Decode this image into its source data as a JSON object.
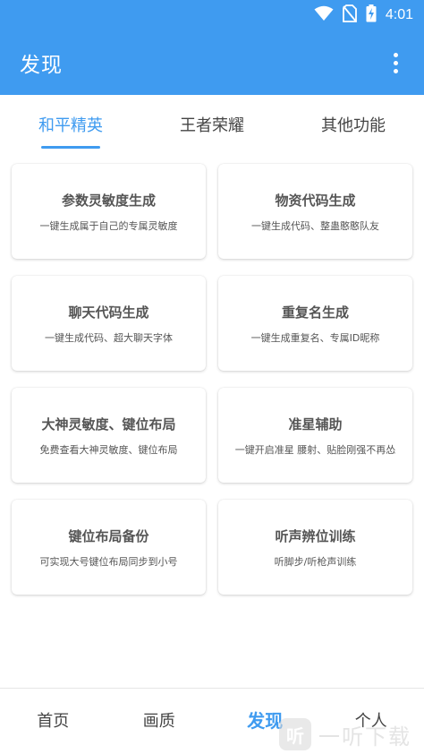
{
  "status_bar": {
    "time": "4:01",
    "icons": [
      "wifi-icon",
      "no-sim-icon",
      "battery-charging-icon"
    ]
  },
  "app_bar": {
    "title": "发现",
    "menu_icon": "more-vert-icon"
  },
  "tabs": [
    {
      "label": "和平精英",
      "active": true
    },
    {
      "label": "王者荣耀",
      "active": false
    },
    {
      "label": "其他功能",
      "active": false
    }
  ],
  "cards": [
    {
      "title": "参数灵敏度生成",
      "desc": "一键生成属于自己的专属灵敏度"
    },
    {
      "title": "物资代码生成",
      "desc": "一键生成代码、整蛊憨憨队友"
    },
    {
      "title": "聊天代码生成",
      "desc": "一键生成代码、超大聊天字体"
    },
    {
      "title": "重复名生成",
      "desc": "一键生成重复名、专属ID昵称"
    },
    {
      "title": "大神灵敏度、键位布局",
      "desc": "免费查看大神灵敏度、键位布局"
    },
    {
      "title": "准星辅助",
      "desc": "一键开启准星 腰射、贴脸刚强不再怂"
    },
    {
      "title": "键位布局备份",
      "desc": "可实现大号键位布局同步到小号"
    },
    {
      "title": "听声辨位训练",
      "desc": "听脚步/听枪声训练"
    }
  ],
  "bottom_nav": [
    {
      "label": "首页",
      "active": false
    },
    {
      "label": "画质",
      "active": false
    },
    {
      "label": "发现",
      "active": true
    },
    {
      "label": "个人",
      "active": false
    }
  ],
  "watermark": {
    "logo_char": "听",
    "text": "一听下载"
  },
  "colors": {
    "primary": "#3f9bf0",
    "text": "#444444",
    "card_text": "#555555"
  }
}
